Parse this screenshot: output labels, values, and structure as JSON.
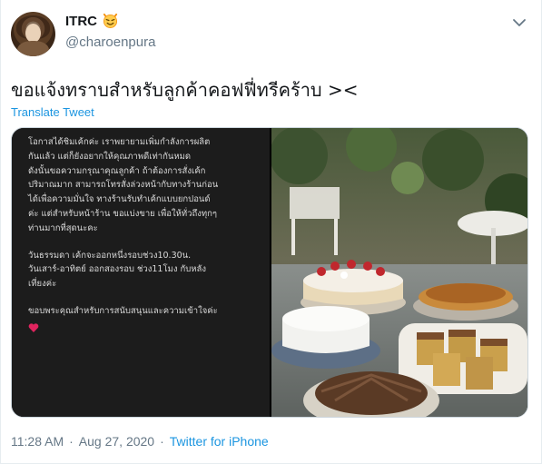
{
  "author": {
    "name": "ITRC",
    "handle": "@charoenpura",
    "name_emoji": "smiling-devil-emoji"
  },
  "tweet": {
    "text": "ขอแจ้งทราบสำหรับลูกค้าคอฟฟี่ทรีคร้าบ ><",
    "translate_label": "Translate Tweet"
  },
  "media": {
    "notice_paragraphs": [
      "โอกาสได้ชิมเค้กค่ะ เราพยายามเพิ่มกำลังการผลิต\nกันแล้ว แต่ก็ยังอยากให้คุณภาพดีเท่ากันหมด\nดังนั้นขอความกรุณาคุณลูกค้า ถ้าต้องการสั่งเค้ก\nปริมาณมาก สามารถโทรสั่งล่วงหน้ากับทางร้านก่อน\nได้เพื่อความมั่นใจ ทางร้านรับทำเค้กแบบยกปอนด์\nค่ะ แต่สำหรับหน้าร้าน ขอแบ่งขาย เพื่อให้ทั่วถึงทุกๆ\nท่านมากที่สุดนะคะ",
      "วันธรรมดา เค้กจะออกหนึ่งรอบช่วง10.30น.\nวันเสาร์-อาทิตย์ ออกสองรอบ ช่วง11โมง กับหลัง\nเที่ยงค่ะ",
      "ขอบพระคุณสำหรับการสนับสนุนและความเข้าใจค่ะ"
    ],
    "notice_emoji": "red-heart-emoji",
    "photo_subject": "cakes-on-table-photo"
  },
  "footer": {
    "time": "11:28 AM",
    "separator": "·",
    "date": "Aug 27, 2020",
    "source": "Twitter for iPhone"
  },
  "colors": {
    "link": "#1b95e0",
    "secondary": "#657786",
    "notice_bg": "#1c1c1c"
  }
}
